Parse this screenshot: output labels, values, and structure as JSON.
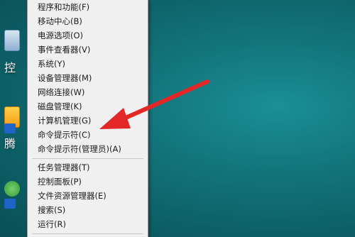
{
  "desktop": {
    "background_color": "#13757c",
    "icons": [
      {
        "name": "control-panel-icon",
        "label": "控"
      },
      {
        "name": "tencent-app-icon",
        "label": "腾"
      },
      {
        "name": "green-app-icon",
        "label": ""
      }
    ]
  },
  "menu": {
    "groups": [
      [
        {
          "label": "程序和功能(F)"
        },
        {
          "label": "移动中心(B)"
        },
        {
          "label": "电源选项(O)"
        },
        {
          "label": "事件查看器(V)"
        },
        {
          "label": "系统(Y)"
        },
        {
          "label": "设备管理器(M)"
        },
        {
          "label": "网络连接(W)"
        },
        {
          "label": "磁盘管理(K)"
        },
        {
          "label": "计算机管理(G)"
        },
        {
          "label": "命令提示符(C)"
        },
        {
          "label": "命令提示符(管理员)(A)"
        }
      ],
      [
        {
          "label": "任务管理器(T)"
        },
        {
          "label": "控制面板(P)"
        },
        {
          "label": "文件资源管理器(E)"
        },
        {
          "label": "搜索(S)"
        },
        {
          "label": "运行(R)"
        }
      ]
    ]
  },
  "annotation": {
    "icon": "red-arrow-icon",
    "color": "#e32626"
  }
}
